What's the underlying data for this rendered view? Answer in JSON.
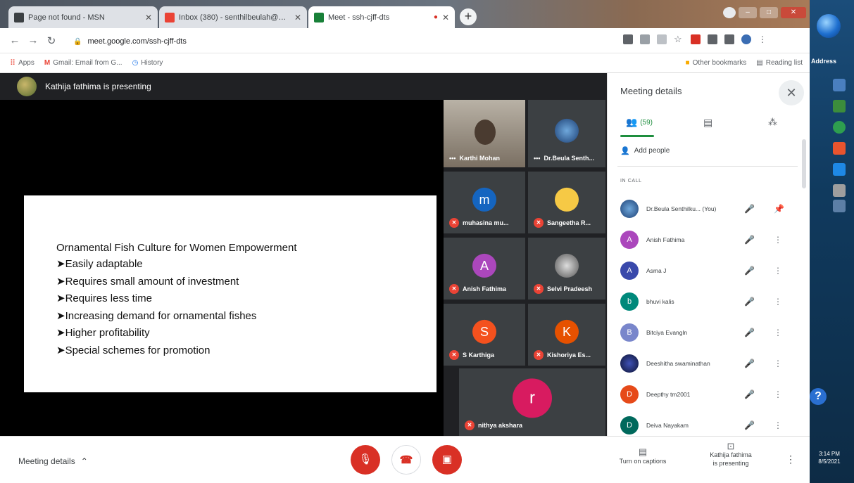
{
  "browser": {
    "tabs": [
      {
        "title": "Page not found - MSN",
        "favicon_color": "#3c4043"
      },
      {
        "title": "Inbox (380) - senthilbeulah@gm...",
        "favicon_color": "#ea4335"
      },
      {
        "title": "Meet - ssh-cjff-dts",
        "favicon_color": "#188038"
      }
    ],
    "new_tab_label": "+",
    "url": "meet.google.com/ssh-cjff-dts",
    "bookmarks": {
      "apps": "Apps",
      "gmail": "Gmail: Email from G...",
      "history": "History",
      "other": "Other bookmarks",
      "reading": "Reading list"
    }
  },
  "meet": {
    "presenter_text": "Kathija fathima is presenting",
    "slide": {
      "title": "Ornamental Fish Culture for Women Empowerment",
      "bullets": [
        "➤Easily adaptable",
        "➤Requires small amount of investment",
        "➤Requires less time",
        "➤Increasing demand for ornamental fishes",
        "➤Higher profitability",
        "➤Special schemes for promotion"
      ]
    },
    "tiles": [
      {
        "name": "Karthi Mohan",
        "initial": "",
        "color": "#6b5a4a"
      },
      {
        "name": "Dr.Beula Senth...",
        "initial": "",
        "color": "#3b6db3"
      },
      {
        "name": "muhasina mu...",
        "initial": "m",
        "color": "#1565c0"
      },
      {
        "name": "Sangeetha R...",
        "initial": "",
        "color": "#f6c945"
      },
      {
        "name": "Anish Fathima",
        "initial": "A",
        "color": "#ab47bc"
      },
      {
        "name": "Selvi Pradeesh",
        "initial": "",
        "color": "#8d8d8d"
      },
      {
        "name": "S Karthiga",
        "initial": "S",
        "color": "#f4511e"
      },
      {
        "name": "Kishoriya Es...",
        "initial": "K",
        "color": "#e65100"
      },
      {
        "name": "nithya akshara",
        "initial": "r",
        "color": "#d81b60"
      }
    ]
  },
  "sidebar": {
    "title": "Meeting details",
    "close": "✕",
    "people_tab": "(59)",
    "add_people": "Add people",
    "in_call": "IN CALL",
    "people": [
      {
        "name": "Dr.Beula Senthilku... (You)",
        "initial": "",
        "color": "#3b6db3"
      },
      {
        "name": "Anish Fathima",
        "initial": "A",
        "color": "#ab47bc"
      },
      {
        "name": "Asma J",
        "initial": "A",
        "color": "#3949ab"
      },
      {
        "name": "bhuvi kalis",
        "initial": "b",
        "color": "#00897b"
      },
      {
        "name": "Bitciya Evangln",
        "initial": "B",
        "color": "#7986cb"
      },
      {
        "name": "Deeshitha swaminathan",
        "initial": "",
        "color": "#1a237e"
      },
      {
        "name": "Deepthy tm2001",
        "initial": "D",
        "color": "#e64a19"
      },
      {
        "name": "Deiva Nayakam",
        "initial": "D",
        "color": "#00695c"
      }
    ]
  },
  "bottom": {
    "meeting_details": "Meeting details",
    "captions": "Turn on captions",
    "presenting_line1": "Kathija fathima",
    "presenting_line2": "is presenting"
  },
  "desktop": {
    "address": "Address",
    "time": "3:14 PM",
    "date": "8/5/2021",
    "help": "?"
  }
}
